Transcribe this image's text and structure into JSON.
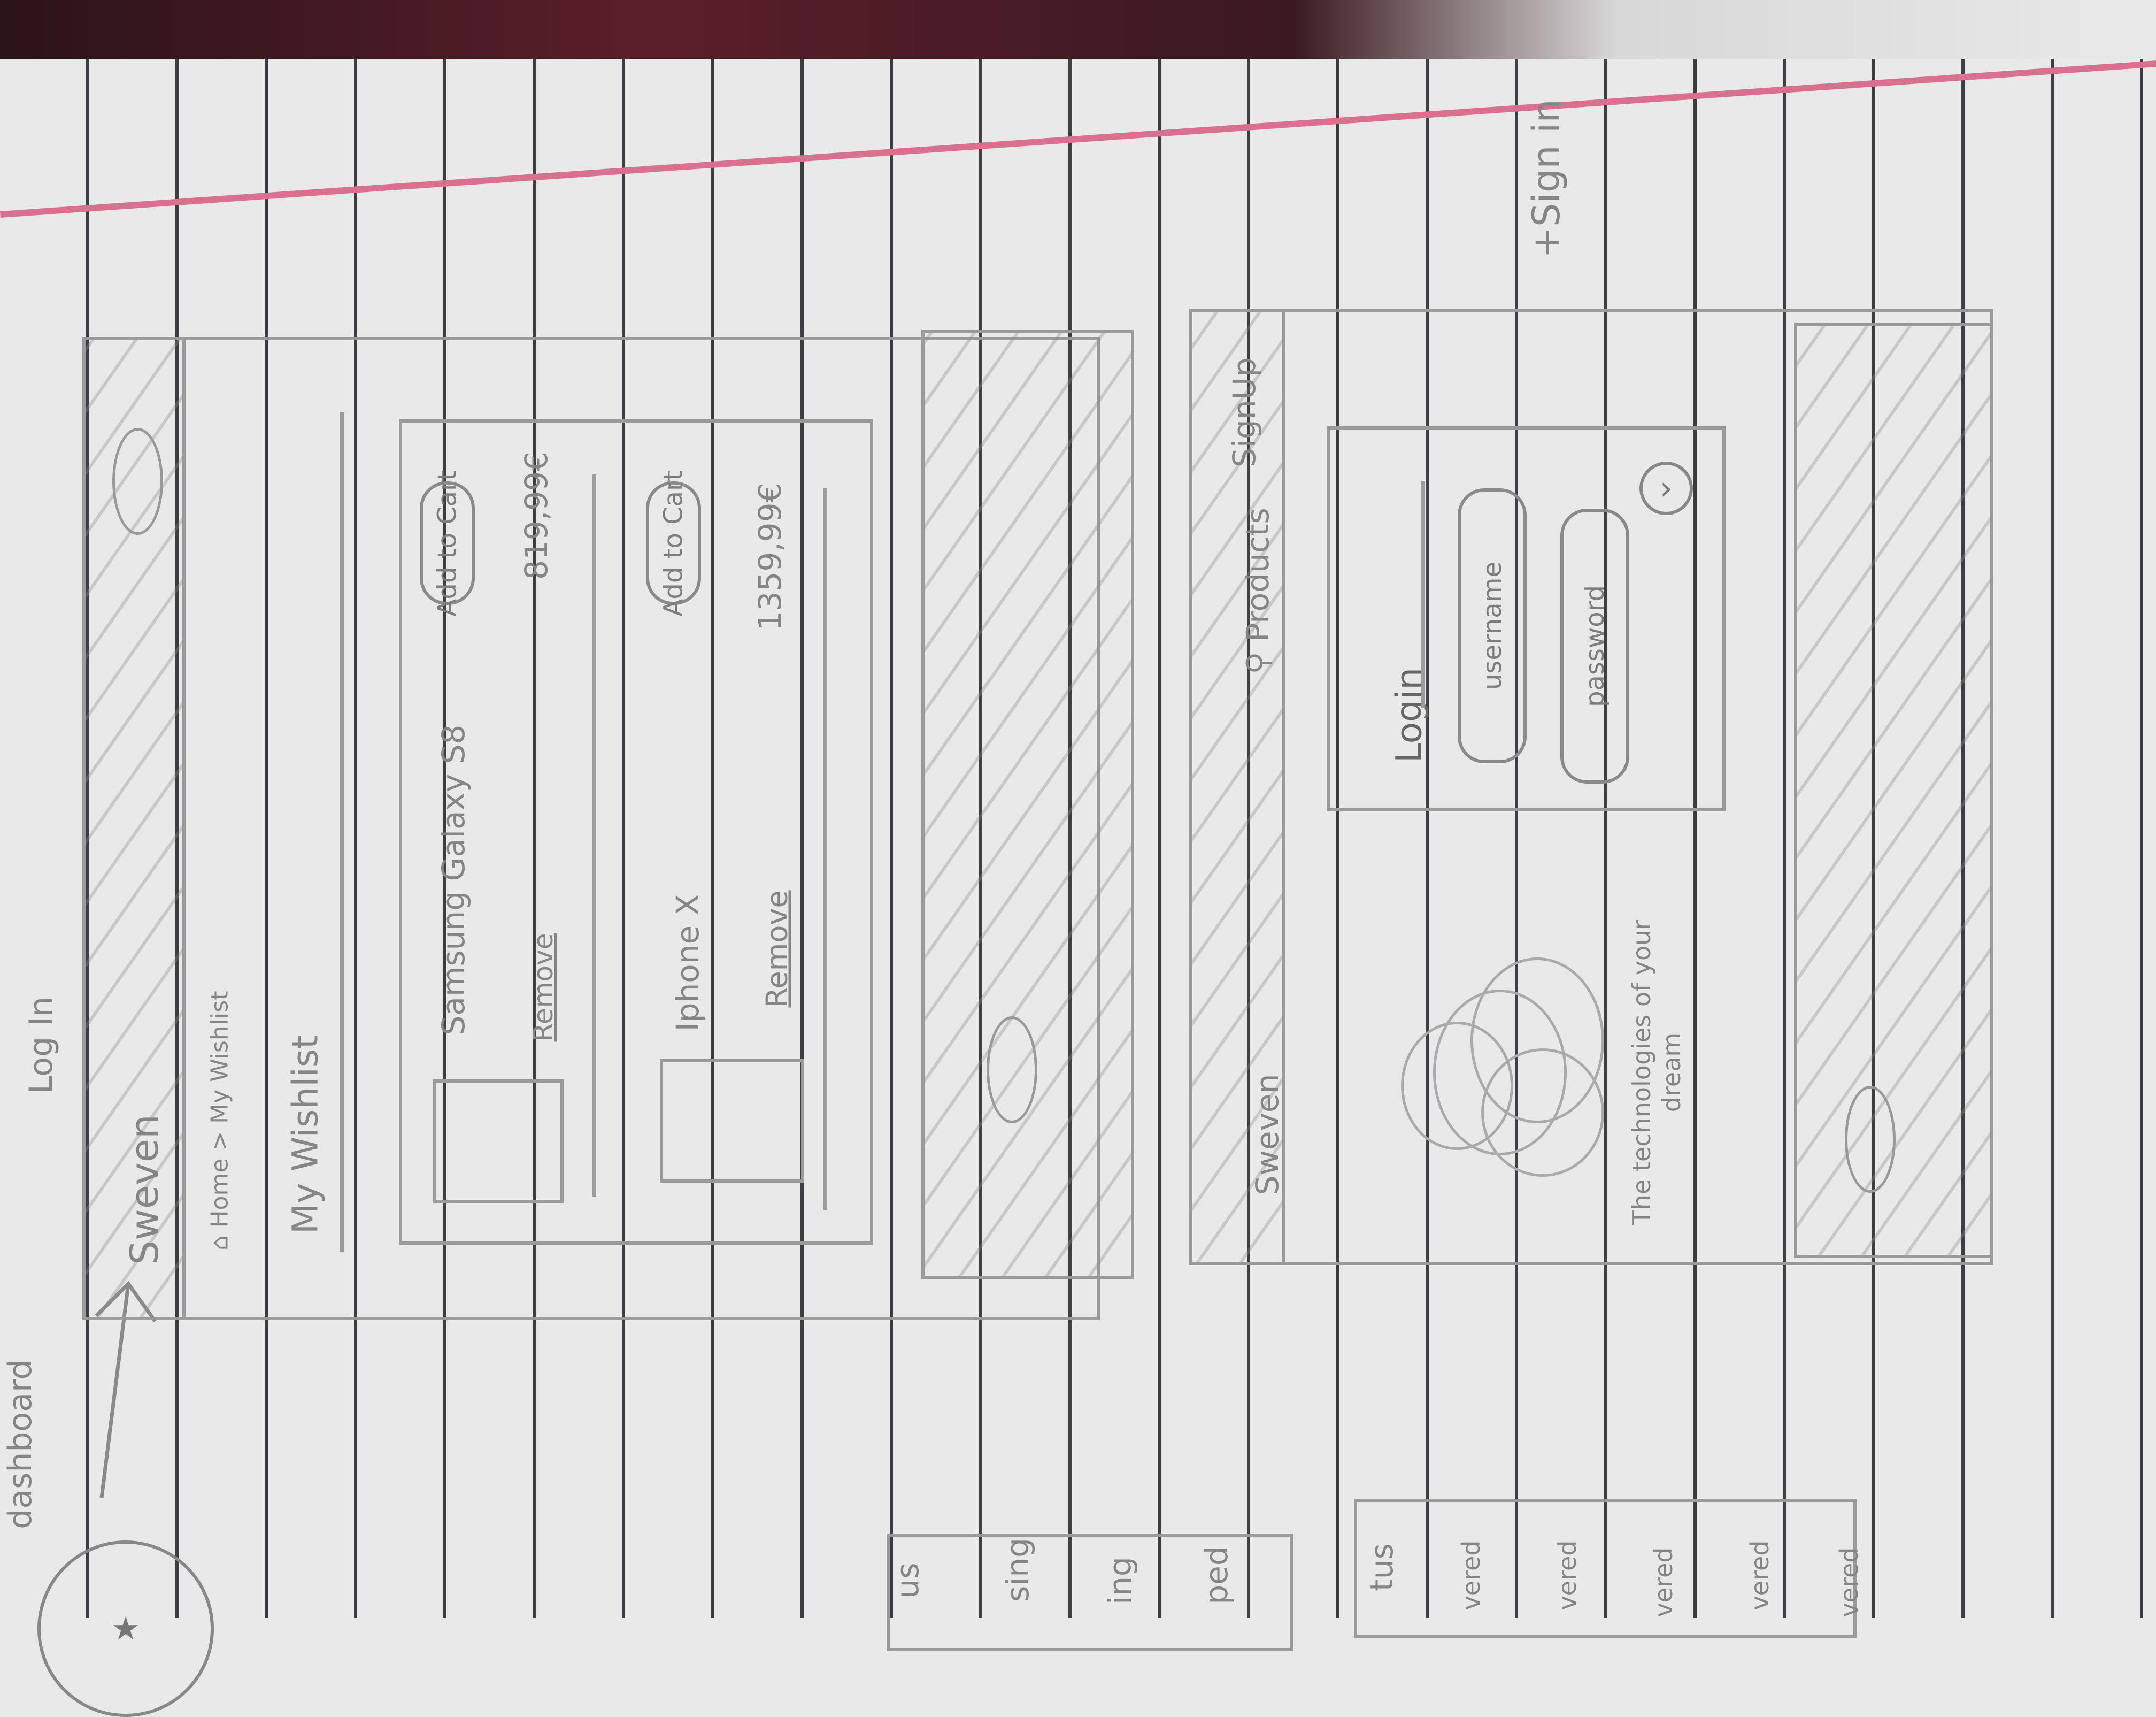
{
  "top_fragment": {
    "dashboard": "dashboard",
    "login": "Log In"
  },
  "wishlist_page": {
    "brand": "Sweven",
    "logo_icon": "oval-logo",
    "breadcrumb": "Home > My Wishlist",
    "breadcrumb_icon": "home-icon",
    "title": "My Wishlist",
    "items": [
      {
        "name": "Samsung Galaxy S8",
        "add_to_cart": "Add to Cart",
        "price": "819,99€",
        "remove": "Remove"
      },
      {
        "name": "Iphone X",
        "add_to_cart": "Add to Cart",
        "price": "1359,99€",
        "remove": "Remove"
      }
    ]
  },
  "login_page": {
    "brand": "Sweven",
    "search_icon": "search-icon",
    "nav_products": "Products",
    "nav_signup": "SignUp",
    "login_title": "Login",
    "username_placeholder": "username",
    "password_placeholder": "password",
    "submit_icon": "arrow-circle-icon",
    "tagline": "The technologies of your dream"
  },
  "annotation": "+Sign in",
  "bottom_fragments": {
    "list1": [
      "us",
      "sing",
      "ing",
      "ped"
    ],
    "list2": [
      "tus",
      "vered",
      "vered",
      "vered",
      "vered",
      "vered"
    ]
  },
  "colors": {
    "paper": "#e9e9ea",
    "rule": "#3d3d42",
    "margin": "#d9708f",
    "pencil": "#8a8a8a"
  }
}
